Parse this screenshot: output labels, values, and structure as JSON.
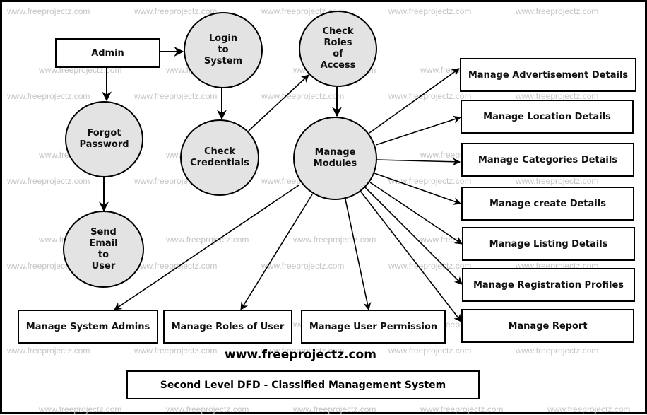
{
  "diagram": {
    "title": "Second Level DFD - Classified Management System",
    "website": "www.freeprojectz.com",
    "watermark": "www.freeprojectz.com",
    "colors": {
      "process_fill": "#e3e3e3",
      "stroke": "#000000",
      "watermark": "#c4c4c4"
    },
    "entities": {
      "admin": "Admin",
      "advertisement": "Manage Advertisement Details",
      "location": "Manage Location Details",
      "categories": "Manage Categories Details",
      "create": "Manage create Details",
      "listing": "Manage Listing Details",
      "registration": "Manage Registration Profiles",
      "report": "Manage Report",
      "system_admins": "Manage System Admins",
      "roles_of_user": "Manage Roles of User",
      "user_permission": "Manage User Permission"
    },
    "processes": {
      "login": "Login\nto\nSystem",
      "check_roles": "Check\nRoles\nof\nAccess",
      "forgot_password": "Forgot\nPassword",
      "check_credentials": "Check\nCredentials",
      "manage_modules": "Manage\nModules",
      "send_email": "Send\nEmail\nto\nUser"
    },
    "flows": [
      {
        "from": "admin",
        "to": "login"
      },
      {
        "from": "admin",
        "to": "forgot_password"
      },
      {
        "from": "login",
        "to": "check_credentials"
      },
      {
        "from": "check_credentials",
        "to": "check_roles"
      },
      {
        "from": "check_roles",
        "to": "manage_modules"
      },
      {
        "from": "forgot_password",
        "to": "send_email"
      },
      {
        "from": "manage_modules",
        "to": "advertisement"
      },
      {
        "from": "manage_modules",
        "to": "location"
      },
      {
        "from": "manage_modules",
        "to": "categories"
      },
      {
        "from": "manage_modules",
        "to": "create"
      },
      {
        "from": "manage_modules",
        "to": "listing"
      },
      {
        "from": "manage_modules",
        "to": "registration"
      },
      {
        "from": "manage_modules",
        "to": "report"
      },
      {
        "from": "manage_modules",
        "to": "system_admins"
      },
      {
        "from": "manage_modules",
        "to": "roles_of_user"
      },
      {
        "from": "manage_modules",
        "to": "user_permission"
      }
    ]
  }
}
